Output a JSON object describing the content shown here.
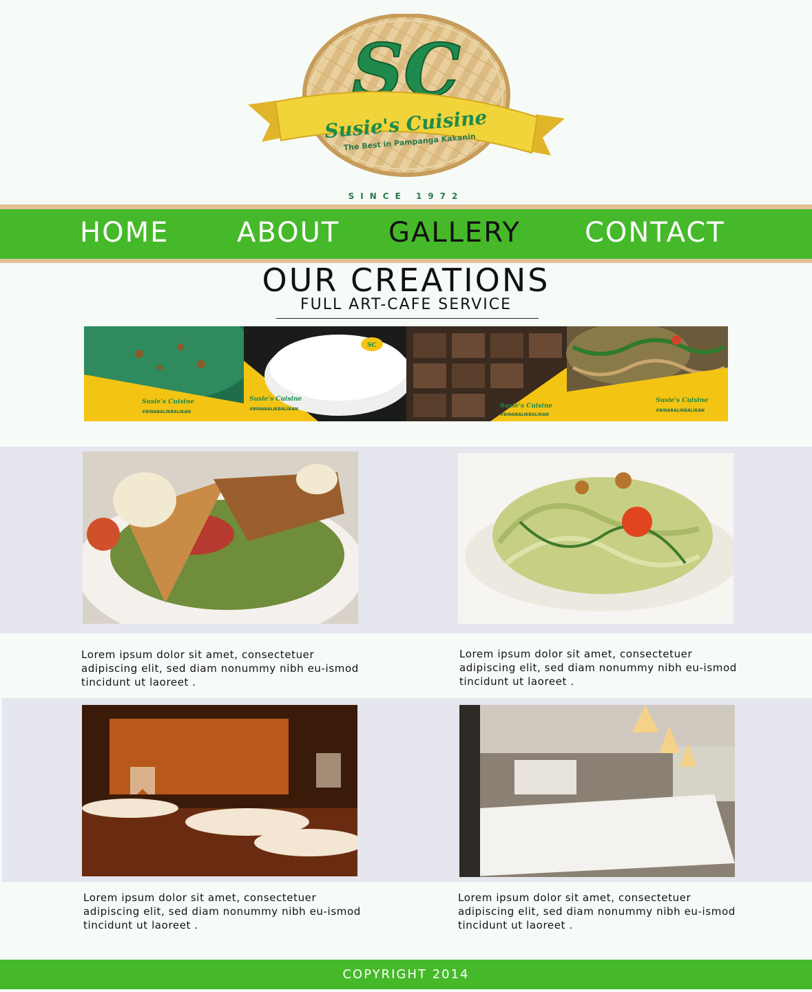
{
  "logo": {
    "monogram": "SC",
    "brand_name": "Susie's Cuisine",
    "tagline": "The Best in Pampanga Kakanin",
    "since": "SINCE 1972"
  },
  "nav": {
    "items": [
      {
        "label": "HOME"
      },
      {
        "label": "ABOUT"
      },
      {
        "label": "GALLERY"
      },
      {
        "label": "CONTACT"
      }
    ],
    "active": "GALLERY"
  },
  "section": {
    "title": "OUR CREATIONS",
    "subtitle": "FULL ART-CAFE SERVICE"
  },
  "banner": {
    "tiles": [
      {
        "brand": "Susie's Cuisine",
        "hashtag": "#BINABALIKBALIKAN"
      },
      {
        "brand": "Susie's Cuisine",
        "hashtag": "#BINABALIKBALIKAN"
      },
      {
        "brand": "Susie's Cuisine",
        "hashtag": "#BINABALIKBALIKAN"
      },
      {
        "brand": "Susie's Cuisine",
        "hashtag": "#BINABALIKBALIKAN"
      }
    ]
  },
  "gallery": {
    "items": [
      {
        "caption": "Lorem ipsum dolor sit amet, consectetuer adipiscing elit, sed diam nonummy nibh eu-ismod tincidunt ut laoreet ."
      },
      {
        "caption": "Lorem ipsum dolor sit amet, consectetuer adipiscing elit, sed diam nonummy nibh eu-ismod tincidunt ut laoreet ."
      },
      {
        "caption": "Lorem ipsum dolor sit amet, consectetuer adipiscing elit, sed diam nonummy nibh eu-ismod tincidunt ut laoreet ."
      },
      {
        "caption": "Lorem ipsum dolor sit amet, consectetuer adipiscing elit, sed diam nonummy nibh eu-ismod tincidunt ut laoreet ."
      }
    ]
  },
  "footer": {
    "copyright": "COPYRIGHT 2014"
  },
  "colors": {
    "nav_green": "#46b92a",
    "nav_rule": "#e3bf95",
    "logo_green": "#1f8a4c",
    "ribbon_yellow": "#f1d33a",
    "band_gray": "#e5e6ee",
    "page_bg": "#f6fbf8"
  }
}
